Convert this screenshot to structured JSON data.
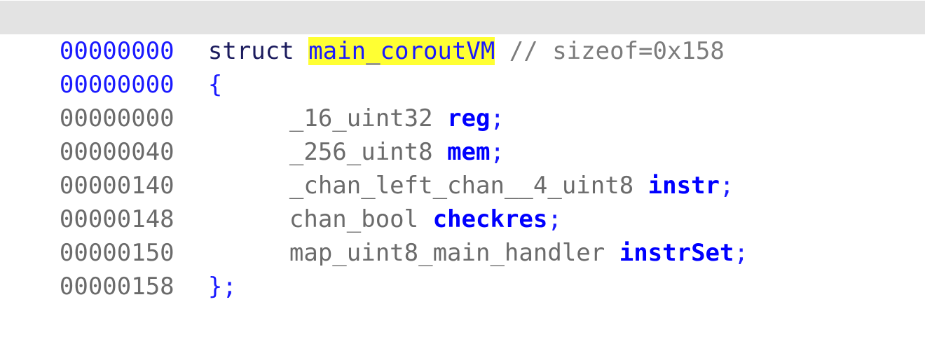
{
  "lines": [
    {
      "addr": "00000000",
      "keyword": "struct",
      "name": "main_coroutVM",
      "comment": "// sizeof=0x158"
    },
    {
      "addr": "00000000",
      "punct": "{"
    },
    {
      "addr": "00000000",
      "type": "_16_uint32",
      "field": "reg",
      "semi": ";"
    },
    {
      "addr": "00000040",
      "type": "_256_uint8",
      "field": "mem",
      "semi": ";"
    },
    {
      "addr": "00000140",
      "type": "_chan_left_chan__4_uint8",
      "field": "instr",
      "semi": ";"
    },
    {
      "addr": "00000148",
      "type": "chan_bool",
      "field": "checkres",
      "semi": ";"
    },
    {
      "addr": "00000150",
      "type": "map_uint8_main_handler",
      "field": "instrSet",
      "semi": ";"
    },
    {
      "addr": "00000158",
      "punct": "};"
    }
  ]
}
